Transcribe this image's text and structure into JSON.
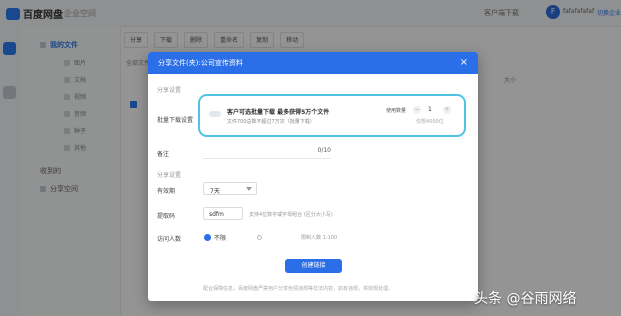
{
  "header": {
    "logo_text": "百度网盘",
    "enterprise_label": "企业空间",
    "client_download": "客户端下载",
    "avatar_initial": "F",
    "username": "fafafafafaf",
    "top_link": "切换企业"
  },
  "sidebar": {
    "items": [
      {
        "label": "我的文件"
      },
      {
        "label": "收到的"
      },
      {
        "label": "分享空间"
      }
    ],
    "sub_items": [
      "图片",
      "文档",
      "视频",
      "音频",
      "种子",
      "其他"
    ]
  },
  "toolbar": {
    "buttons": [
      "分享",
      "下载",
      "删除",
      "重命名",
      "复制",
      "移动"
    ]
  },
  "list": {
    "columns": [
      "全部文件",
      "大小"
    ]
  },
  "modal": {
    "title": "分享文件(夹):公司宣传资料",
    "section_basic": "分享设置",
    "batch_label": "批量下载设置",
    "batch_title": "客户可选批量下载 最多获得5万个文件",
    "batch_desc": "文件700总数不超过7万次（批量下载）",
    "batch_quota_label": "使用数量",
    "batch_value": "1",
    "batch_hint": "仅限4000位",
    "count_label": "备注",
    "count_value": "0/10",
    "section_advanced": "分享设置",
    "validity_label": "有效期",
    "validity_value": "7天",
    "code_label": "提取码",
    "code_value": "sdfm",
    "code_hint": "支持4位数字或字母组合 (区分大小写)",
    "visitor_label": "访问人数",
    "visitor_unlimited": "不限",
    "visitor_hint": "限制人数 1-100",
    "create_button": "创建链接",
    "footer_note": "配合保障信息，百度网盘严禁用户分享色情违规等非法内容，如有违规，将依规处理。"
  },
  "watermark": "头条 @谷雨网络",
  "colors": {
    "accent": "#2b6fe8",
    "highlight_border": "#4ec4e2"
  }
}
